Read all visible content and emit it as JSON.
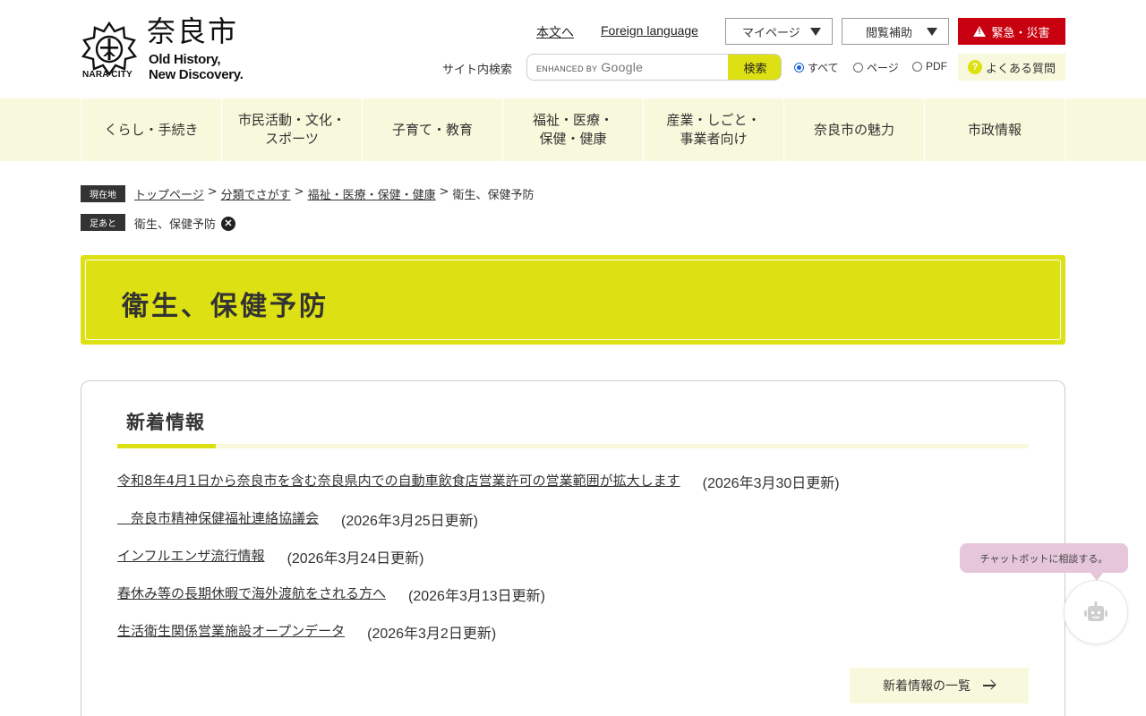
{
  "header": {
    "logo_city": "NARA CITY",
    "logo_jp": "奈良市",
    "logo_en_line1": "Old History,",
    "logo_en_line2": "New Discovery.",
    "link_main": "本文へ",
    "link_foreign": "Foreign language",
    "mypage": "マイページ",
    "assist": "閲覧補助",
    "emergency": "緊急・災害",
    "search_label": "サイト内検索",
    "search_enhanced": "ENHANCED BY",
    "search_google": "Google",
    "search_button": "検索",
    "radio_all": "すべて",
    "radio_page": "ページ",
    "radio_pdf": "PDF",
    "faq": "よくある質問"
  },
  "nav": {
    "items": [
      {
        "l1": "くらし・手続き",
        "l2": ""
      },
      {
        "l1": "市民活動・文化・",
        "l2": "スポーツ"
      },
      {
        "l1": "子育て・教育",
        "l2": ""
      },
      {
        "l1": "福祉・医療・",
        "l2": "保健・健康"
      },
      {
        "l1": "産業・しごと・",
        "l2": "事業者向け"
      },
      {
        "l1": "奈良市の魅力",
        "l2": ""
      },
      {
        "l1": "市政情報",
        "l2": ""
      }
    ]
  },
  "breadcrumb": {
    "current_tag": "現在地",
    "links": [
      "トップページ",
      "分類でさがす",
      "福祉・医療・保健・健康"
    ],
    "current": "衛生、保健予防",
    "history_tag": "足あと",
    "history_item": "衛生、保健予防",
    "separator": ">"
  },
  "page_title": "衛生、保健予防",
  "news": {
    "title": "新着情報",
    "items": [
      {
        "text": "令和8年4月1日から奈良市を含む奈良県内での自動車飲食店営業許可の営業範囲が拡大します",
        "date": "(2026年3月30日更新)"
      },
      {
        "text": "　奈良市精神保健福祉連絡協議会",
        "date": "(2026年3月25日更新)"
      },
      {
        "text": "インフルエンザ流行情報",
        "date": "(2026年3月24日更新)"
      },
      {
        "text": "春休み等の長期休暇で海外渡航をされる方へ",
        "date": "(2026年3月13日更新)"
      },
      {
        "text": "生活衛生関係営業施設オープンデータ",
        "date": "(2026年3月2日更新)"
      }
    ],
    "more": "新着情報の一覧"
  },
  "chatbot": {
    "bubble": "チャットボットに相談する。"
  },
  "colors": {
    "accent": "#dde012",
    "pale": "#f8f9dc",
    "emergency": "#c8000f"
  }
}
